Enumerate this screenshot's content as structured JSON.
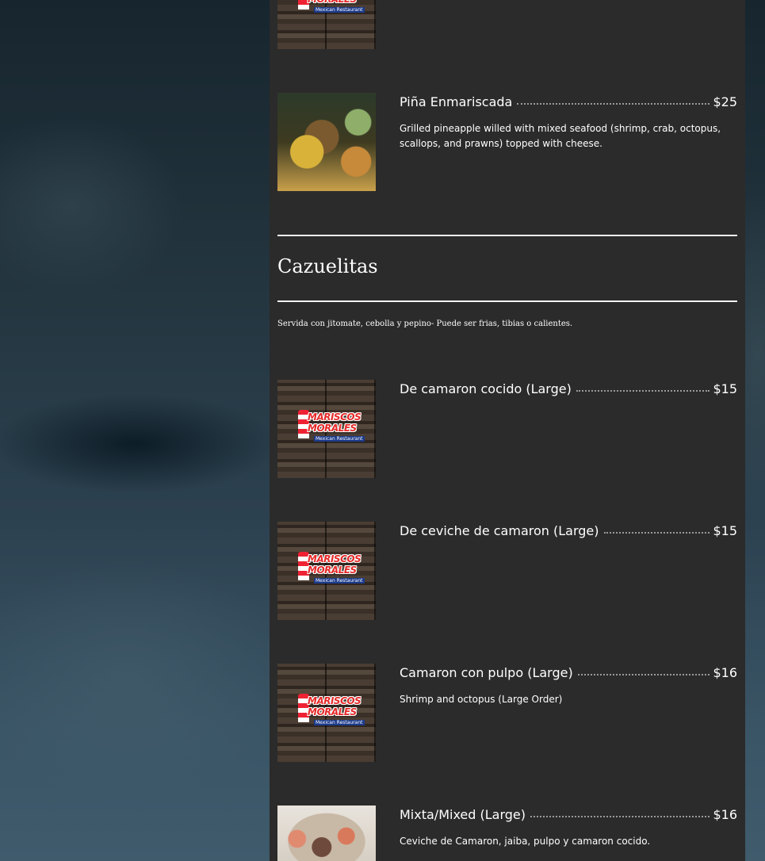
{
  "logo": {
    "line1": "MARISCOS",
    "line2": "MORALES",
    "line3": "Mexican Restaurant"
  },
  "items_top": [
    {
      "name": "Piña Enmariscada",
      "price": "$25",
      "description": "Grilled pineapple willed with mixed seafood (shrimp, crab, octopus, scallops, and prawns) topped with cheese."
    }
  ],
  "section": {
    "title": "Cazuelitas",
    "subtitle": "Servida con jitomate, cebolla y pepino- Puede ser frias, tibias o calientes."
  },
  "items": [
    {
      "name": "De camaron cocido (Large)",
      "price": "$15",
      "description": ""
    },
    {
      "name": "De ceviche de camaron (Large)",
      "price": "$15",
      "description": ""
    },
    {
      "name": "Camaron con pulpo (Large)",
      "price": "$16",
      "description": "Shrimp and octopus (Large Order)"
    },
    {
      "name": "Mixta/Mixed (Large)",
      "price": "$16",
      "description": "Ceviche de Camaron, jaiba, pulpo y camaron cocido."
    }
  ]
}
